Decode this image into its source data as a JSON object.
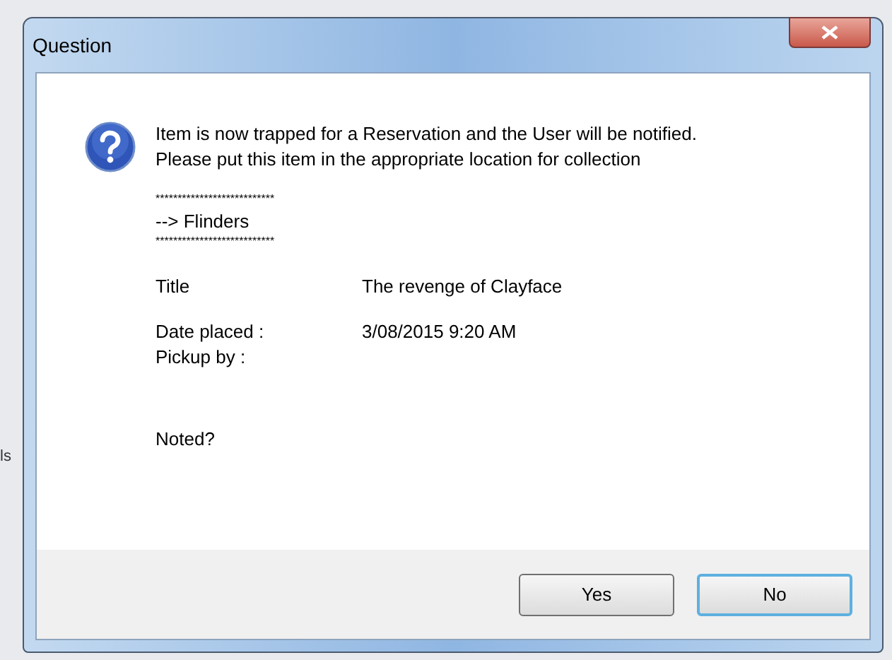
{
  "background": {
    "fragment": "ls"
  },
  "window": {
    "title": "Question"
  },
  "message": {
    "lines": [
      "Item is now trapped for a Reservation and the User will be notified.",
      "Please put this item in the appropriate location for collection"
    ]
  },
  "location": {
    "rule_top": "***************************",
    "text": "--> Flinders",
    "rule_bottom": "***************************"
  },
  "details": [
    {
      "label": "Title",
      "value": "The revenge of Clayface"
    },
    {
      "label": "Date placed :",
      "value": "3/08/2015 9:20 AM"
    },
    {
      "label": "Pickup by :"
    }
  ],
  "prompt": "Noted?",
  "buttons": [
    {
      "label": "Yes",
      "default": false
    },
    {
      "label": "No",
      "default": true
    }
  ]
}
